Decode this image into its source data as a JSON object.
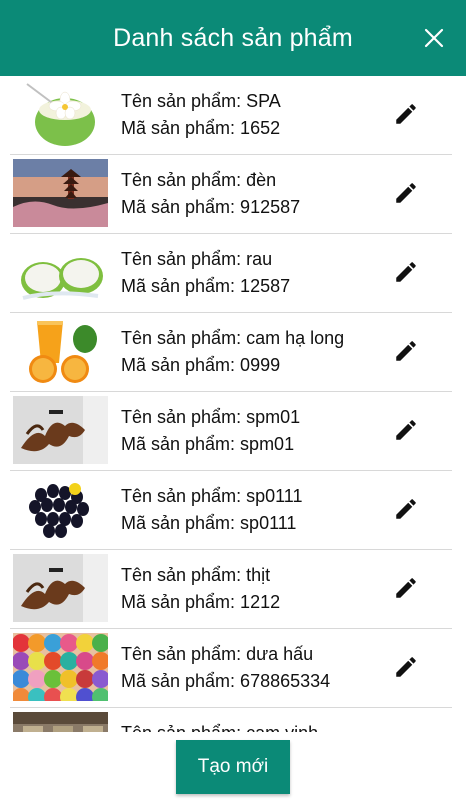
{
  "header": {
    "title": "Danh sách sản phẩm",
    "close_icon": "close-icon"
  },
  "colors": {
    "primary": "#0b8a77",
    "divider": "#d8d8d8"
  },
  "products": [
    {
      "name_line": "Tên sản phẩm: SPA",
      "code_line": "Mã sản phẩm: 1652",
      "image": "coconut-drink"
    },
    {
      "name_line": "Tên sản phẩm: đèn",
      "code_line": "Mã sản phẩm: 912587",
      "image": "pagoda-landscape"
    },
    {
      "name_line": "Tên sản phẩm: rau",
      "code_line": "Mã sản phẩm: 12587",
      "image": "coconut-split"
    },
    {
      "name_line": "Tên sản phẩm: cam hạ long",
      "code_line": "Mã sản phẩm: 0999",
      "image": "orange-juice"
    },
    {
      "name_line": "Tên sản phẩm: spm01",
      "code_line": "Mã sản phẩm: spm01",
      "image": "driftwood"
    },
    {
      "name_line": "Tên sản phẩm: sp0111",
      "code_line": "Mã sản phẩm: sp0111",
      "image": "black-grapes"
    },
    {
      "name_line": "Tên sản phẩm: thịt",
      "code_line": "Mã sản phẩm: 1212",
      "image": "driftwood"
    },
    {
      "name_line": "Tên sản phẩm: dưa hấu",
      "code_line": "Mã sản phẩm: 678865334",
      "image": "yarn-balls"
    },
    {
      "name_line": "Tên sản phẩm: cam vinh",
      "code_line": "",
      "image": "room-interior"
    }
  ],
  "footer": {
    "create_label": "Tạo mới"
  }
}
